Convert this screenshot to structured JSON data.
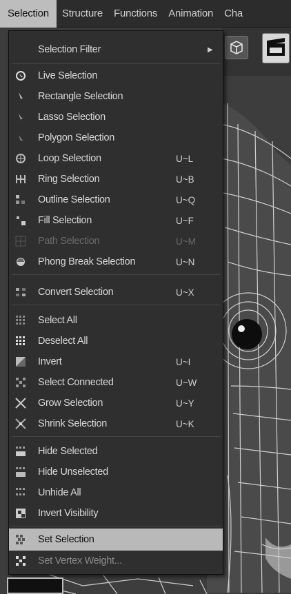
{
  "menubar": {
    "items": [
      "Selection",
      "Structure",
      "Functions",
      "Animation",
      "Cha"
    ]
  },
  "menu": {
    "items": [
      {
        "label": "Selection Filter",
        "shortcut": "",
        "submenu": true,
        "icon": "none-icon"
      },
      {
        "label": "Live Selection",
        "shortcut": "",
        "icon": "live-selection-icon"
      },
      {
        "label": "Rectangle Selection",
        "shortcut": "",
        "icon": "rectangle-selection-icon"
      },
      {
        "label": "Lasso Selection",
        "shortcut": "",
        "icon": "lasso-selection-icon"
      },
      {
        "label": "Polygon Selection",
        "shortcut": "",
        "icon": "polygon-selection-icon"
      },
      {
        "label": "Loop Selection",
        "shortcut": "U~L",
        "icon": "loop-selection-icon"
      },
      {
        "label": "Ring Selection",
        "shortcut": "U~B",
        "icon": "ring-selection-icon"
      },
      {
        "label": "Outline Selection",
        "shortcut": "U~Q",
        "icon": "outline-selection-icon"
      },
      {
        "label": "Fill Selection",
        "shortcut": "U~F",
        "icon": "fill-selection-icon"
      },
      {
        "label": "Path Selection",
        "shortcut": "U~M",
        "icon": "path-selection-icon",
        "disabled": true
      },
      {
        "label": "Phong Break Selection",
        "shortcut": "U~N",
        "icon": "phong-break-icon"
      },
      {
        "label": "Convert Selection",
        "shortcut": "U~X",
        "icon": "convert-selection-icon"
      },
      {
        "label": "Select All",
        "shortcut": "",
        "icon": "select-all-icon"
      },
      {
        "label": "Deselect All",
        "shortcut": "",
        "icon": "deselect-all-icon"
      },
      {
        "label": "Invert",
        "shortcut": "U~I",
        "icon": "invert-icon"
      },
      {
        "label": "Select Connected",
        "shortcut": "U~W",
        "icon": "select-connected-icon"
      },
      {
        "label": "Grow Selection",
        "shortcut": "U~Y",
        "icon": "grow-selection-icon"
      },
      {
        "label": "Shrink Selection",
        "shortcut": "U~K",
        "icon": "shrink-selection-icon"
      },
      {
        "label": "Hide Selected",
        "shortcut": "",
        "icon": "hide-selected-icon"
      },
      {
        "label": "Hide Unselected",
        "shortcut": "",
        "icon": "hide-unselected-icon"
      },
      {
        "label": "Unhide All",
        "shortcut": "",
        "icon": "unhide-all-icon"
      },
      {
        "label": "Invert Visibility",
        "shortcut": "",
        "icon": "invert-visibility-icon"
      },
      {
        "label": "Set Selection",
        "shortcut": "",
        "icon": "set-selection-icon",
        "highlighted": true
      },
      {
        "label": "Set Vertex Weight...",
        "shortcut": "",
        "icon": "set-vertex-weight-icon"
      }
    ]
  },
  "colors": {
    "menu_bg": "#2f2f2f",
    "highlight": "#b9b9b9",
    "text": "#d8d8d8",
    "disabled_text": "#6a6a6a"
  }
}
